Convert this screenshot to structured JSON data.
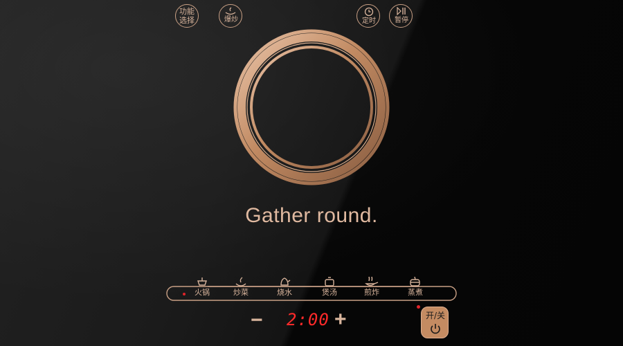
{
  "tagline": "Gather round.",
  "modes": [
    {
      "label": "火锅",
      "icon": "hotpot-icon"
    },
    {
      "label": "炒菜",
      "icon": "stir-fry-icon"
    },
    {
      "label": "烧水",
      "icon": "kettle-icon"
    },
    {
      "label": "煲汤",
      "icon": "soup-pot-icon"
    },
    {
      "label": "煎炸",
      "icon": "frying-pan-icon"
    },
    {
      "label": "蒸煮",
      "icon": "steamer-icon"
    }
  ],
  "controls": {
    "function_select": "功能选择",
    "burst_fry": "爆炒",
    "minus": "−",
    "display": "2:00",
    "plus": "+",
    "timer": "定时",
    "pause": "暂停",
    "power": "开/关"
  },
  "colors": {
    "accent": "#c9a085",
    "display": "#ff2a2a",
    "indicator": "#e0242a"
  }
}
